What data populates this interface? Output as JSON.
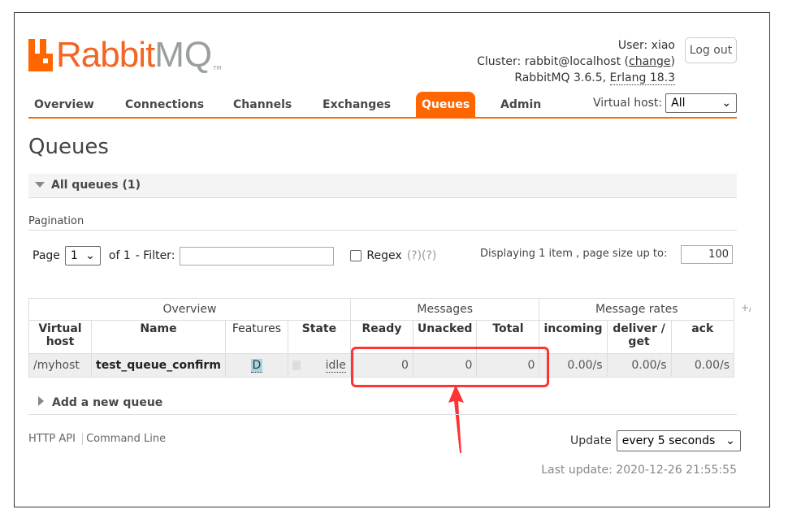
{
  "logo": {
    "text_orange": "Rabbit",
    "text_gray": "MQ",
    "tm": "TM"
  },
  "user": {
    "user_label": "User:",
    "user": "xiao",
    "cluster_label": "Cluster:",
    "cluster": "rabbit@localhost",
    "change": "change",
    "version": "RabbitMQ 3.6.5,",
    "erlang": "Erlang 18.3",
    "logout": "Log out"
  },
  "nav": {
    "tabs": [
      "Overview",
      "Connections",
      "Channels",
      "Exchanges",
      "Queues",
      "Admin"
    ],
    "active": "Queues",
    "vhost_label": "Virtual host:",
    "vhost_value": "All"
  },
  "page_title": "Queues",
  "section": {
    "all_queues": "All queues (1)",
    "pagination": "Pagination",
    "page_label": "Page",
    "page_value": "1",
    "of": "of 1",
    "filter_label": "- Filter:",
    "regex": "Regex",
    "help": "(?)(?)",
    "displaying": "Displaying 1 item , page size up to:",
    "page_size": "100"
  },
  "table": {
    "groups": [
      "Overview",
      "Messages",
      "Message rates"
    ],
    "plus": "+/-",
    "columns": [
      "Virtual host",
      "Name",
      "Features",
      "State",
      "Ready",
      "Unacked",
      "Total",
      "incoming",
      "deliver / get",
      "ack"
    ],
    "rows": [
      {
        "vhost": "/myhost",
        "name": "test_queue_confirm",
        "features": "D",
        "state": "idle",
        "ready": "0",
        "unacked": "0",
        "total": "0",
        "incoming": "0.00/s",
        "deliver": "0.00/s",
        "ack": "0.00/s"
      }
    ]
  },
  "add_queue": "Add a new queue",
  "footer": {
    "http_api": "HTTP API",
    "command_line": "Command Line",
    "update_label": "Update",
    "update_value": "every 5 seconds",
    "last_update": "Last update: 2020-12-26 21:55:55"
  },
  "colors": {
    "accent": "#ff6600",
    "annotation": "#ff3333"
  }
}
